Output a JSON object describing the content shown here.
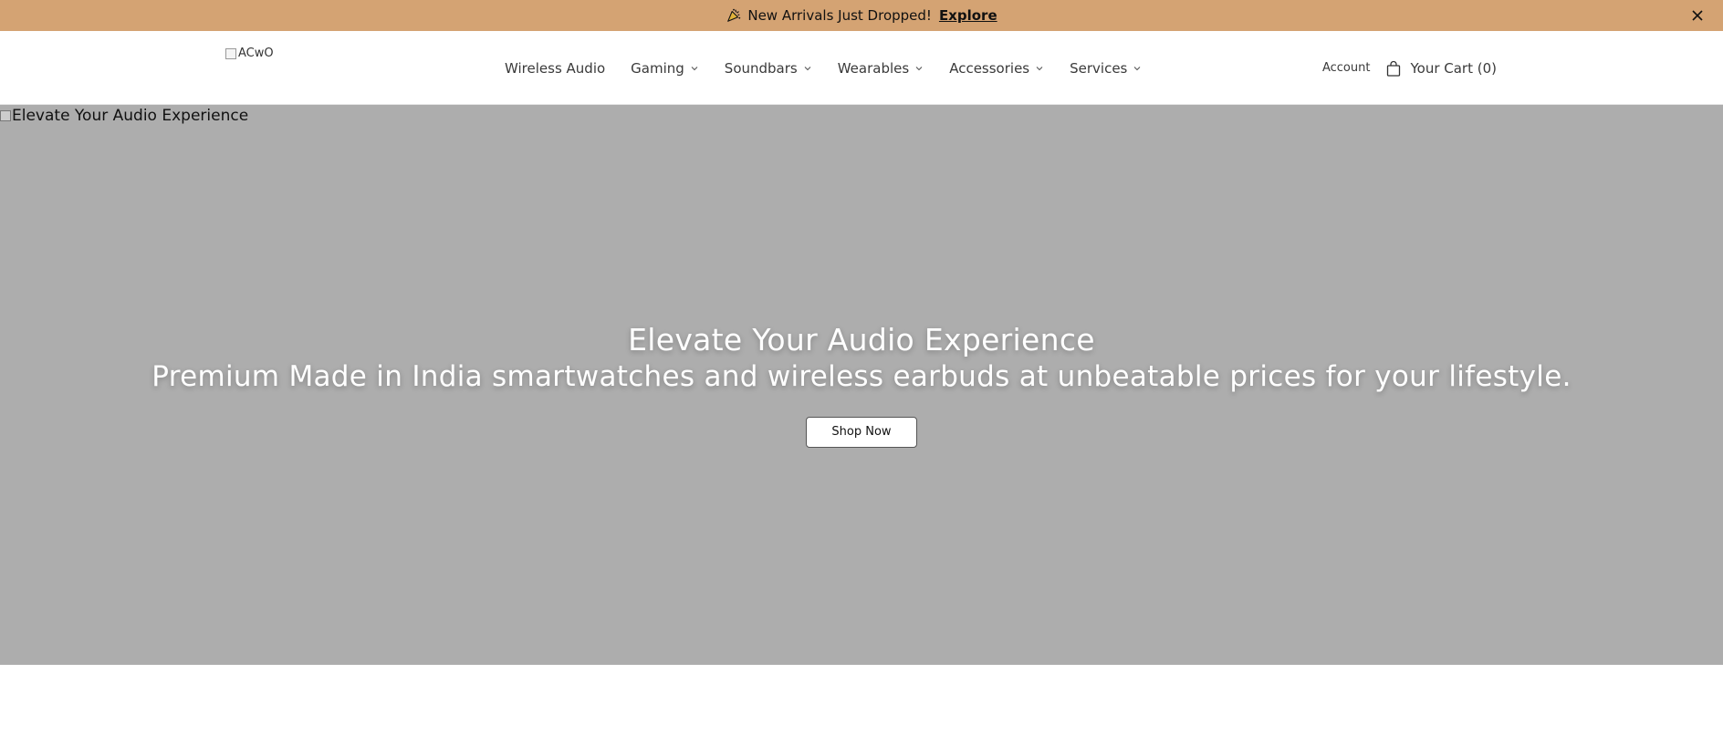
{
  "announcement": {
    "text": "New Arrivals Just Dropped!",
    "link_label": "Explore",
    "background": "#d4a373"
  },
  "header": {
    "logo_alt": "ACwO",
    "nav": [
      {
        "label": "Wireless Audio",
        "has_dropdown": false
      },
      {
        "label": "Gaming",
        "has_dropdown": true
      },
      {
        "label": "Soundbars",
        "has_dropdown": true
      },
      {
        "label": "Wearables",
        "has_dropdown": true
      },
      {
        "label": "Accessories",
        "has_dropdown": true
      },
      {
        "label": "Services",
        "has_dropdown": true
      }
    ],
    "account_label": "Account",
    "cart_label": "Your Cart (0)"
  },
  "hero": {
    "image_alt": "Elevate Your Audio Experience",
    "title": "Elevate Your Audio Experience",
    "subtitle": "Premium Made in India smartwatches and wireless earbuds at unbeatable prices for your lifestyle.",
    "cta_label": "Shop Now",
    "background": "#adadad"
  }
}
